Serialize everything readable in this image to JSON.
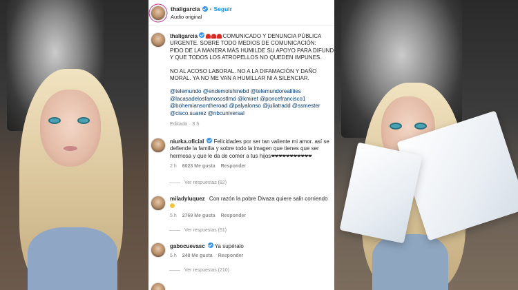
{
  "post": {
    "username": "thaligarcia",
    "follow_label": "Seguir",
    "audio_label": "Audio original",
    "caption_lines": [
      "COMUNICADO Y DENUNCIA PÚBLICA",
      "URGENTE. SOBRE TODO MEDIOS DE COMUNICACIÓN:",
      "PIDO DE LA MANERA MÁS HUMILDE SU APOYO PARA DIFUNDIR",
      "Y QUE TODOS LOS ATROPELLOS NO QUEDEN IMPUNES."
    ],
    "caption_lines_2": [
      "NO AL ACOSO LABORAL. NO A LA DIFAMACIÓN Y DAÑO",
      "MORAL. YA NO ME VAN A HUMILLAR NI A SILENCIAR."
    ],
    "mentions_lines": [
      "@telemundo @endemolshinebd @telemundorealities",
      "@lacasadelosfamosostlmd @kmiret @poncefrancisco1",
      "@bohemiansontheroad @palyalonso @juliatradd @ssmester",
      "@cisco.suarez @nbcuniversal"
    ],
    "edited_label": "Editado",
    "edited_time": "3 h"
  },
  "comments": [
    {
      "username": "niurka.oficial",
      "lines": [
        "Felicidades por ser tan valiente mi amor. así se",
        "defiende la familia y sobre todo la imagen que tienes que ser",
        "hermosa y que le da de comer a tus hijos"
      ],
      "hearts": "❤❤❤❤❤❤❤❤❤❤❤",
      "time": "2 h",
      "likes": "6023 Me gusta",
      "reply_label": "Responder",
      "replies_label": "Ver respuestas (82)"
    },
    {
      "username": "miladyluquez",
      "lines": [
        "Con razón la pobre Divaza quiere salir corriendo"
      ],
      "time": "5 h",
      "likes": "2769 Me gusta",
      "reply_label": "Responder",
      "replies_label": "Ver respuestas (51)"
    },
    {
      "username": "gabocuevasc",
      "lines": [
        "Ya supéralo"
      ],
      "time": "5 h",
      "likes": "248 Me gusta",
      "reply_label": "Responder",
      "replies_label": "Ver respuestas (210)"
    }
  ],
  "colors": {
    "link_blue": "#0095f6",
    "mention_blue": "#00376b",
    "verified_blue": "#3897f0",
    "muted_gray": "#8e8e8e"
  },
  "icons": [
    "verified-badge-icon",
    "alarm-light-icon",
    "smiley-emoji-icon",
    "heart-icon",
    "more-options-icon"
  ]
}
